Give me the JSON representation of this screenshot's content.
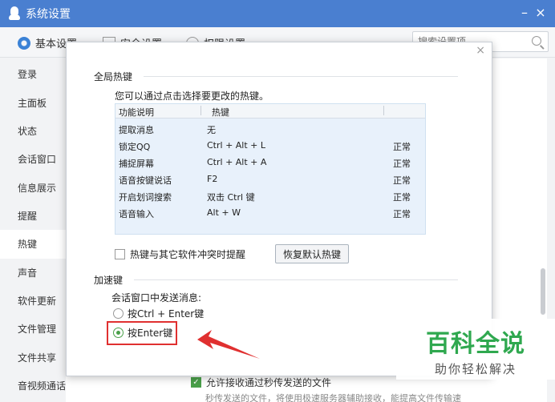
{
  "window": {
    "title": "系统设置",
    "minimize": "–",
    "close": "×"
  },
  "tabs": [
    {
      "label": "基本设置"
    },
    {
      "label": "安全设置"
    },
    {
      "label": "权限设置"
    }
  ],
  "search": {
    "placeholder": "搜索设置项"
  },
  "sidebar": {
    "items": [
      "登录",
      "主面板",
      "状态",
      "会话窗口",
      "信息展示",
      "提醒",
      "热键",
      "声音",
      "软件更新",
      "文件管理",
      "文件共享",
      "音视频通话"
    ],
    "active": "热键"
  },
  "dialog": {
    "close": "×",
    "global_title": "全局热键",
    "description": "您可以通过点击选择要更改的热键。",
    "table": {
      "headers": [
        "功能说明",
        "热键"
      ],
      "rows": [
        {
          "name": "提取消息",
          "key": "无",
          "status": ""
        },
        {
          "name": "锁定QQ",
          "key": "Ctrl + Alt + L",
          "status": "正常"
        },
        {
          "name": "捕捉屏幕",
          "key": "Ctrl + Alt + A",
          "status": "正常"
        },
        {
          "name": "语音按键说话",
          "key": "F2",
          "status": "正常"
        },
        {
          "name": "开启划词搜索",
          "key": "双击 Ctrl 键",
          "status": "正常"
        },
        {
          "name": "语音输入",
          "key": "Alt + W",
          "status": "正常"
        }
      ]
    },
    "conflict_label": "热键与其它软件冲突时提醒",
    "restore_button": "恢复默认热键",
    "accel_title": "加速键",
    "send_label": "会话窗口中发送消息:",
    "options": [
      {
        "label": "按Ctrl + Enter键",
        "selected": false
      },
      {
        "label": "按Enter键",
        "selected": true
      }
    ]
  },
  "background": {
    "option_label": "允许接收通过秒传发送的文件",
    "option_desc": "秒传发送的文件，将使用极速服务器辅助接收，能提高文件传输速"
  },
  "watermark": {
    "main": "百科全说",
    "sub": "助你轻松解决"
  },
  "colors": {
    "titlebar": "#4a7fd0",
    "accent": "#3b82d6",
    "highlight": "#e03030",
    "watermark": "#2fa84f"
  }
}
